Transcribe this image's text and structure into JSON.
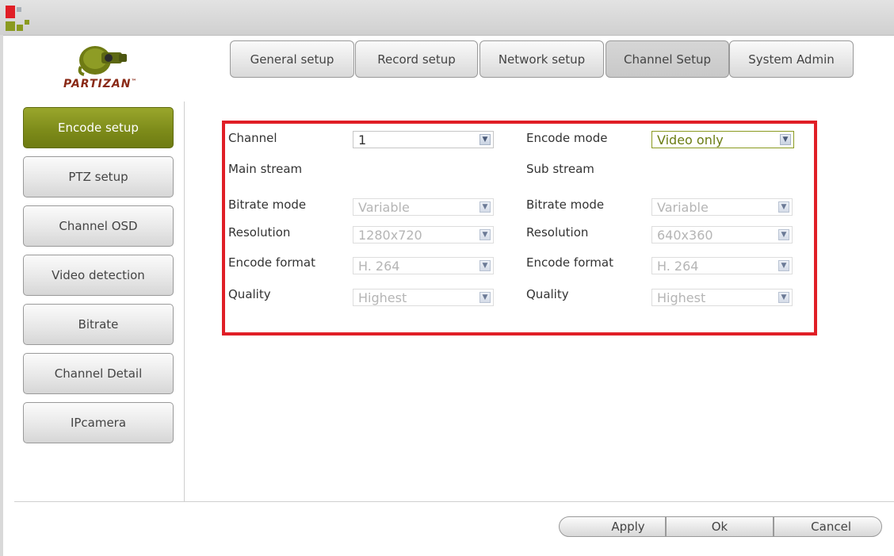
{
  "tabs": [
    {
      "label": "General setup",
      "active": false
    },
    {
      "label": "Record setup",
      "active": false
    },
    {
      "label": "Network setup",
      "active": false
    },
    {
      "label": "Channel Setup",
      "active": true
    },
    {
      "label": "System Admin",
      "active": false
    }
  ],
  "brand": {
    "name": "PARTIZAN",
    "tm": "™"
  },
  "sidebar": {
    "items": [
      {
        "label": "Encode setup",
        "active": true
      },
      {
        "label": "PTZ setup",
        "active": false
      },
      {
        "label": "Channel OSD",
        "active": false
      },
      {
        "label": "Video detection",
        "active": false
      },
      {
        "label": "Bitrate",
        "active": false
      },
      {
        "label": "Channel Detail",
        "active": false
      },
      {
        "label": "IPcamera",
        "active": false
      }
    ]
  },
  "form": {
    "channel_label": "Channel",
    "channel_value": "1",
    "encode_mode_label": "Encode mode",
    "encode_mode_value": "Video only",
    "main_stream_label": "Main stream",
    "sub_stream_label": "Sub stream",
    "main": {
      "bitrate_mode_label": "Bitrate mode",
      "bitrate_mode_value": "Variable",
      "resolution_label": "Resolution",
      "resolution_value": "1280x720",
      "encode_format_label": "Encode format",
      "encode_format_value": "H. 264",
      "quality_label": "Quality",
      "quality_value": "Highest"
    },
    "sub": {
      "bitrate_mode_label": "Bitrate mode",
      "bitrate_mode_value": "Variable",
      "resolution_label": "Resolution",
      "resolution_value": "640x360",
      "encode_format_label": "Encode format",
      "encode_format_value": "H. 264",
      "quality_label": "Quality",
      "quality_value": "Highest"
    }
  },
  "footer": {
    "apply": "Apply",
    "ok": "Ok",
    "cancel": "Cancel"
  },
  "colors": {
    "accent": "#7c8a19",
    "highlight_border": "#e01e26",
    "logo_red": "#e01e26",
    "logo_green": "#8a9a20"
  }
}
